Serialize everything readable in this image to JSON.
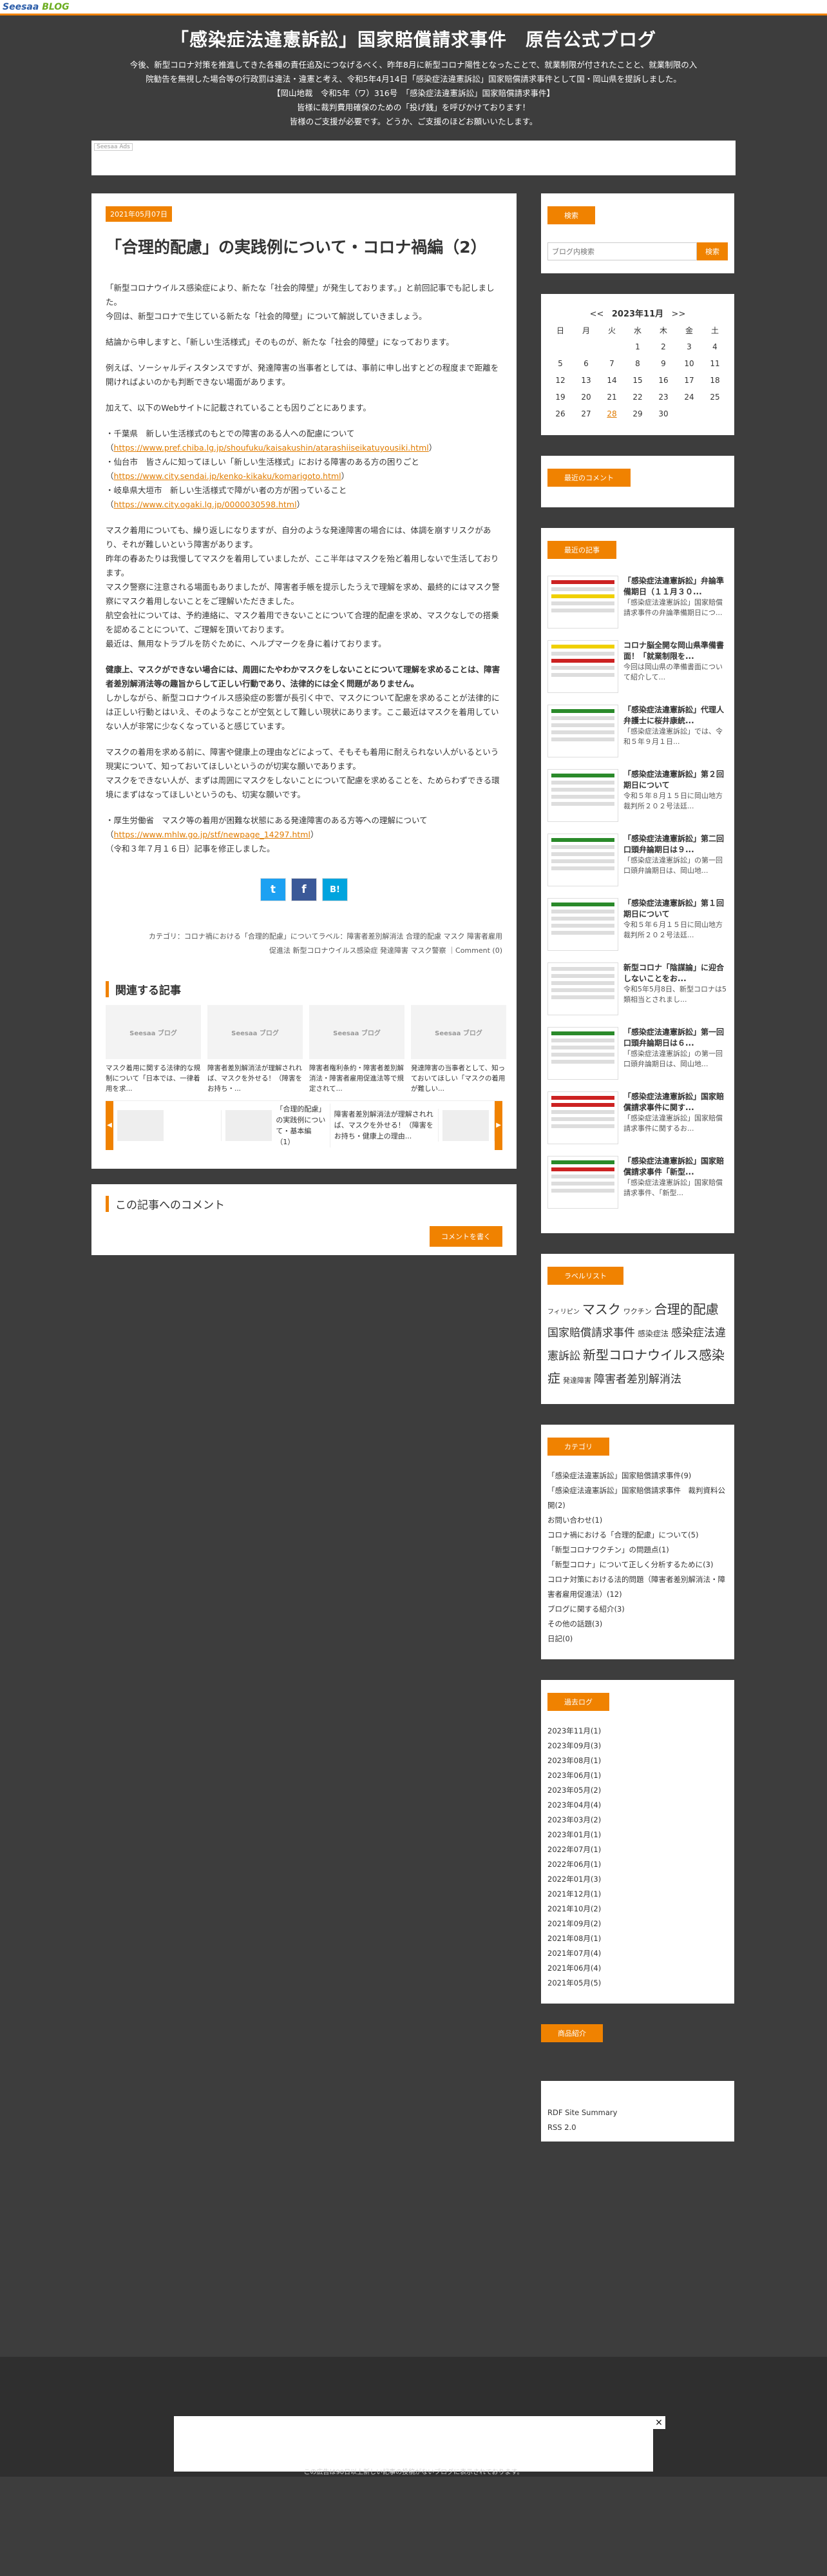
{
  "logo": {
    "a": "Seesaa",
    "b": "BLOG"
  },
  "header": {
    "title": "「感染症法違憲訴訟」国家賠償請求事件　原告公式ブログ",
    "lines": [
      "今後、新型コロナ対策を推進してきた各種の責任追及につなげるべく、昨年8月に新型コロナ陽性となったことで、就業制限が付されたことと、就業制限の入",
      "院勧告を無視した場合等の行政罰は違法・違憲と考え、令和5年4月14日「感染症法違憲訴訟」国家賠償請求事件として国・岡山県を提訴しました。",
      "【岡山地裁　令和5年（ワ）316号　「感染症法違憲訴訟」国家賠償請求事件】",
      "皆様に裁判費用確保のための「投げ銭」を呼びかけております！",
      "皆様のご支援が必要です。どうか、ご支援のほどお願いいたします。"
    ]
  },
  "ad_tag": "Seesaa Ads",
  "post": {
    "date": "2021年05月07日",
    "title": "「合理的配慮」の実践例について・コロナ禍編（2）",
    "p1": "「新型コロナウイルス感染症により、新たな「社会的障壁」が発生しております。」と前回記事でも記しました。\n今回は、新型コロナで生じている新たな「社会的障壁」について解説していきましょう。",
    "p2": "結論から申しますと、「新しい生活様式」そのものが、新たな「社会的障壁」になっております。",
    "p3": "例えば、ソーシャルディスタンスですが、発達障害の当事者としては、事前に申し出すとどの程度まで距離を開ければよいのかも判断できない場面があります。",
    "p4": "加えて、以下のWebサイトに記載されていることも因りごとにあります。",
    "links": [
      {
        "prefix": "・千葉県　新しい生活様式のもとでの障害のある人への配慮について（",
        "url": "https://www.pref.chiba.lg.jp/shoufuku/kaisakushin/atarashiiseikatuyousiki.html",
        "suffix": "）"
      },
      {
        "prefix": "・仙台市　皆さんに知ってほしい「新しい生活様式」における障害のある方の困りごと（",
        "url": "https://www.city.sendai.jp/kenko-kikaku/komarigoto.html",
        "suffix": "）"
      },
      {
        "prefix": "・岐阜県大垣市　新しい生活様式で障がい者の方が困っていること（",
        "url": "https://www.city.ogaki.lg.jp/0000030598.html",
        "suffix": "）"
      }
    ],
    "p5": "マスク着用についても、繰り返しになりますが、自分のような発達障害の場合には、体調を崩すリスクがあり、それが難しいという障害があります。\n昨年の春あたりは我慢してマスクを着用していましたが、ここ半年はマスクを殆ど着用しないで生活しております。\nマスク警察に注意される場面もありましたが、障害者手帳を提示したうえで理解を求め、最終的にはマスク警察にマスク着用しないことをご理解いただきました。\n航空会社については、予約連絡に、マスク着用できないことについて合理的配慮を求め、マスクなしでの搭乗を認めることについて、ご理解を頂いております。\n最近は、無用なトラブルを防ぐために、ヘルプマークを身に着けております。",
    "p6": "健康上、マスクができない場合には、周囲にたやわかマスクをしないことについて理解を求めることは、障害者差別解消法等の趣旨からして正しい行動であり、法律的には全く問題がありません。",
    "p7": "しかしながら、新型コロナウイルス感染症の影響が長引く中で、マスクについて配慮を求めることが法律的には正しい行動とはいえ、そのようなことが空気として難しい現状にあります。ここ最近はマスクを着用していない人が非常に少なくなっていると感じています。",
    "p8": "マスクの着用を求める前に、障害や健康上の理由などによって、そもそも着用に耐えられない人がいるという現実について、知っておいてほしいというのが切実な願いであります。\nマスクをできない人が、まずは周囲にマスクをしないことについて配慮を求めることを、ためらわずできる環境にまずはなってほしいというのも、切実な願いです。",
    "link2": {
      "prefix": "・厚生労働省　マスク等の着用が困難な状態にある発達障害のある方等への理解について（",
      "url": "https://www.mhlw.go.jp/stf/newpage_14297.html",
      "suffix": "）"
    },
    "p9": "（令和３年７月１６日）記事を修正しました。",
    "category_line": "カテゴリ：コロナ禍における「合理的配慮」についてラベル：障害者差別解消法 合理的配慮 マスク 障害者雇用",
    "labels_line": "促進法 新型コロナウイルス感染症 発達障害 マスク警察 ｜Comment (0)"
  },
  "share": {
    "twitter": "t",
    "facebook": "f",
    "hatena": "B!"
  },
  "related": {
    "heading": "関連する記事",
    "thumb_label": "Seesaa ブログ",
    "items": [
      "マスク着用に関する法律的な規制について「日本では、一律着用を求...",
      "障害者差別解消法が理解されれば、マスクを外せる！（障害をお持ち・...",
      "障害者権利条約・障害者差別解消法・障害者雇用促進法等で規定されて...",
      "発達障害の当事者として、知っておいてほしい「マスクの着用が難しい..."
    ]
  },
  "slider": [
    "「合理的配慮」の実践例について・基本編（1）",
    "障害者差別解消法が理解されれば、マスクを外せる！（障害をお持ち・健康上の理由..."
  ],
  "comments": {
    "heading": "この記事へのコメント",
    "button": "コメントを書く"
  },
  "side": {
    "search": {
      "heading": "検索",
      "placeholder": "ブログ内検索",
      "button": "検索"
    },
    "calendar": {
      "prev": "<<",
      "title": "2023年11月",
      "next": ">>",
      "days": [
        "日",
        "月",
        "火",
        "水",
        "木",
        "金",
        "土"
      ],
      "rows": [
        [
          "",
          "",
          "",
          "1",
          "2",
          "3",
          "4"
        ],
        [
          "5",
          "6",
          "7",
          "8",
          "9",
          "10",
          "11"
        ],
        [
          "12",
          "13",
          "14",
          "15",
          "16",
          "17",
          "18"
        ],
        [
          "19",
          "20",
          "21",
          "22",
          "23",
          "24",
          "25"
        ],
        [
          "26",
          "27",
          "28",
          "29",
          "30",
          "",
          ""
        ]
      ],
      "link_day": "28"
    },
    "recent_comments": {
      "heading": "最近のコメント"
    },
    "recent_posts": {
      "heading": "最近の記事",
      "items": [
        {
          "title": "「感染症法違憲訴訟」弁論準備期日（１１月３０...",
          "text": "「感染症法違憲訴訟」国家賠償請求事件の弁論準備期日につ..."
        },
        {
          "title": "コロナ脳全開な岡山県準備書面！「就業制限を...",
          "text": "今回は岡山県の準備書面について紹介して..."
        },
        {
          "title": "「感染症法違憲訴訟」代理人弁護士に桜井康統...",
          "text": "「感染症法違憲訴訟」では、令和５年９月１日..."
        },
        {
          "title": "「感染症法違憲訴訟」第２回期日について",
          "text": "令和５年８月１５日に岡山地方裁判所２０２号法廷..."
        },
        {
          "title": "「感染症法違憲訴訟」第二回口頭弁論期日は９...",
          "text": "「感染症法違憲訴訟」の第一回口頭弁論期日は、岡山地..."
        },
        {
          "title": "「感染症法違憲訴訟」第１回期日について",
          "text": "令和５年６月１５日に岡山地方裁判所２０２号法廷..."
        },
        {
          "title": "新型コロナ「陰謀論」に迎合しないことをお...",
          "text": "令和5年5月8日、新型コロナは5類相当とされまし..."
        },
        {
          "title": "「感染症法違憲訴訟」第一回口頭弁論期日は６...",
          "text": "「感染症法違憲訴訟」の第一回口頭弁論期日は、岡山地..."
        },
        {
          "title": "「感染症法違憲訴訟」国家賠償請求事件に関す...",
          "text": "「感染症法違憲訴訟」国家賠償請求事件に関するお..."
        },
        {
          "title": "「感染症法違憲訴訟」国家賠償請求事件「新型...",
          "text": "「感染症法違憲訴訟」国家賠償請求事件、「新型..."
        }
      ]
    },
    "labels": {
      "heading": "ラベルリスト",
      "items": [
        {
          "t": "フィリピン",
          "s": 10
        },
        {
          "t": "マスク",
          "s": 20
        },
        {
          "t": "ワクチン",
          "s": 11
        },
        {
          "t": "合理的配慮",
          "s": 20
        },
        {
          "t": "国家賠償請求事件",
          "s": 17
        },
        {
          "t": "感染症法",
          "s": 12
        },
        {
          "t": "感染症法違憲訴訟",
          "s": 17
        },
        {
          "t": "新型コロナウイルス感染症",
          "s": 20
        },
        {
          "t": "発達障害",
          "s": 11
        },
        {
          "t": "障害者差別解消法",
          "s": 17
        }
      ]
    },
    "categories": {
      "heading": "カテゴリ",
      "items": [
        "「感染症法違憲訴訟」国家賠償請求事件(9)",
        "「感染症法違憲訴訟」国家賠償請求事件　裁判資料公開(2)",
        "お問い合わせ(1)",
        "コロナ禍における「合理的配慮」について(5)",
        "「新型コロナワクチン」の問題点(1)",
        "「新型コロナ」について正しく分析するために(3)",
        "コロナ対策における法的問題（障害者差別解消法・障害者雇用促進法）(12)",
        "ブログに関する紹介(3)",
        "その他の話題(3)",
        "日記(0)"
      ]
    },
    "archives": {
      "heading": "過去ログ",
      "items": [
        "2023年11月(1)",
        "2023年09月(3)",
        "2023年08月(1)",
        "2023年06月(1)",
        "2023年05月(2)",
        "2023年04月(4)",
        "2023年03月(2)",
        "2023年01月(1)",
        "2022年07月(1)",
        "2022年06月(1)",
        "2022年01月(3)",
        "2021年12月(1)",
        "2021年10月(2)",
        "2021年09月(2)",
        "2021年08月(1)",
        "2021年07月(4)",
        "2021年06月(4)",
        "2021年05月(5)"
      ]
    },
    "products": {
      "heading": "商品紹介"
    },
    "feeds": {
      "items": [
        "RDF Site Summary",
        "RSS 2.0"
      ]
    }
  },
  "footer": {
    "close": "×",
    "note": "この広告は90日以上新しい記事の投稿がないブログに表示されております。"
  }
}
